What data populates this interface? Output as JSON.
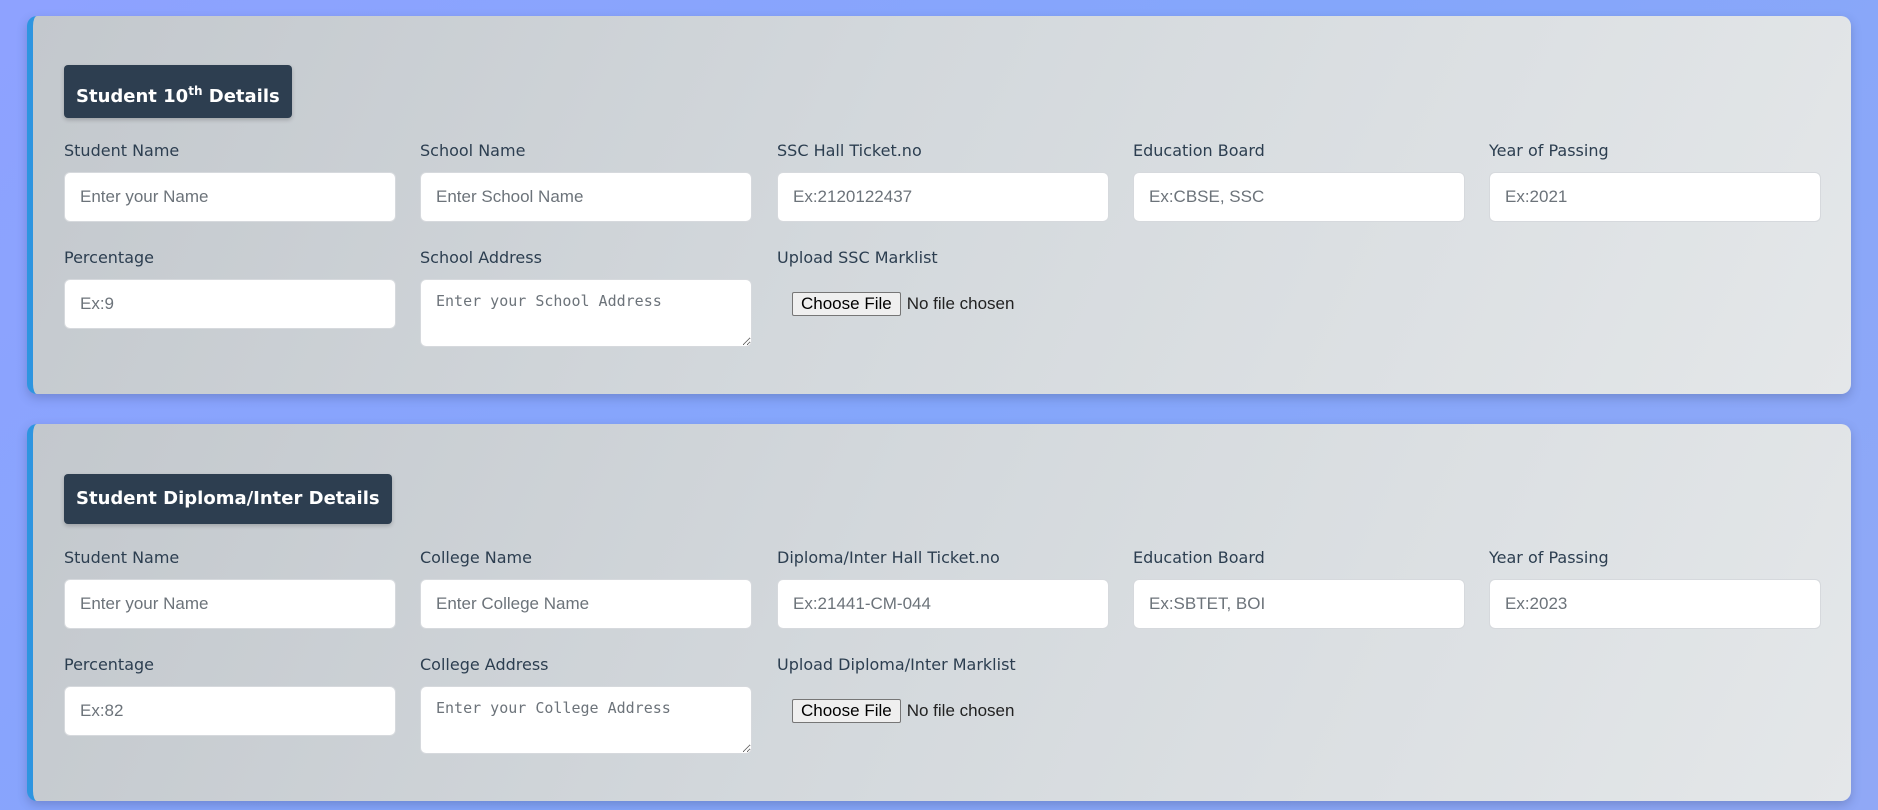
{
  "sections": [
    {
      "title_main": "Student 10",
      "title_sup": "th",
      "title_rest": " Details",
      "fields": {
        "student_name": {
          "label": "Student Name",
          "placeholder": "Enter your Name"
        },
        "institution_name": {
          "label": "School Name",
          "placeholder": "Enter School Name"
        },
        "hall_ticket": {
          "label": "SSC Hall Ticket.no",
          "placeholder": "Ex:2120122437"
        },
        "education_board": {
          "label": "Education Board",
          "placeholder": "Ex:CBSE, SSC"
        },
        "year_of_passing": {
          "label": "Year of Passing",
          "placeholder": "Ex:2021"
        },
        "percentage": {
          "label": "Percentage",
          "placeholder": "Ex:9"
        },
        "address": {
          "label": "School Address",
          "placeholder": "Enter your School Address"
        },
        "upload": {
          "label": "Upload SSC Marklist",
          "button": "Choose File",
          "status": "No file chosen"
        }
      }
    },
    {
      "title_main": "Student Diploma/Inter Details",
      "fields": {
        "student_name": {
          "label": "Student Name",
          "placeholder": "Enter your Name"
        },
        "institution_name": {
          "label": "College Name",
          "placeholder": "Enter College Name"
        },
        "hall_ticket": {
          "label": "Diploma/Inter Hall Ticket.no",
          "placeholder": "Ex:21441-CM-044"
        },
        "education_board": {
          "label": "Education Board",
          "placeholder": "Ex:SBTET, BOI"
        },
        "year_of_passing": {
          "label": "Year of Passing",
          "placeholder": "Ex:2023"
        },
        "percentage": {
          "label": "Percentage",
          "placeholder": "Ex:82"
        },
        "address": {
          "label": "College Address",
          "placeholder": "Enter your College Address"
        },
        "upload": {
          "label": "Upload Diploma/Inter Marklist",
          "button": "Choose File",
          "status": "No file chosen"
        }
      }
    }
  ],
  "colors": {
    "page_background": "#8ea2ff",
    "title_badge": "#2d3e50",
    "card_accent": "#2e95e0",
    "label_text": "#2c3e50"
  }
}
